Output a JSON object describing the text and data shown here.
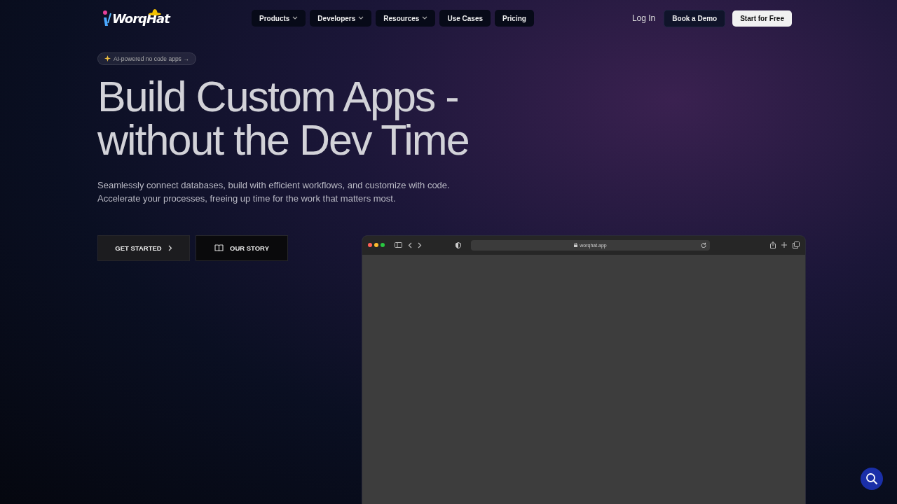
{
  "nav": {
    "logo": "WorqHat",
    "items": [
      {
        "label": "Products",
        "dropdown": true
      },
      {
        "label": "Developers",
        "dropdown": true
      },
      {
        "label": "Resources",
        "dropdown": true
      },
      {
        "label": "Use Cases",
        "dropdown": false
      },
      {
        "label": "Pricing",
        "dropdown": false
      }
    ],
    "login": "Log In",
    "demo": "Book a Demo",
    "cta": "Start for Free"
  },
  "hero": {
    "badge": "AI-powered no code apps →",
    "title_lines": [
      "Build Custom Apps -",
      "without the Dev Time"
    ],
    "subtitle_lines": [
      "Seamlessly connect databases, build with efficient workflows, and customize with code.",
      "Accelerate your processes, freeing up time for the work that matters most."
    ],
    "buttons": [
      {
        "label": "GET STARTED",
        "kind": "primary"
      },
      {
        "label": "OUR STORY",
        "kind": "secondary"
      }
    ]
  },
  "browser": {
    "url": "worqhat.app"
  }
}
